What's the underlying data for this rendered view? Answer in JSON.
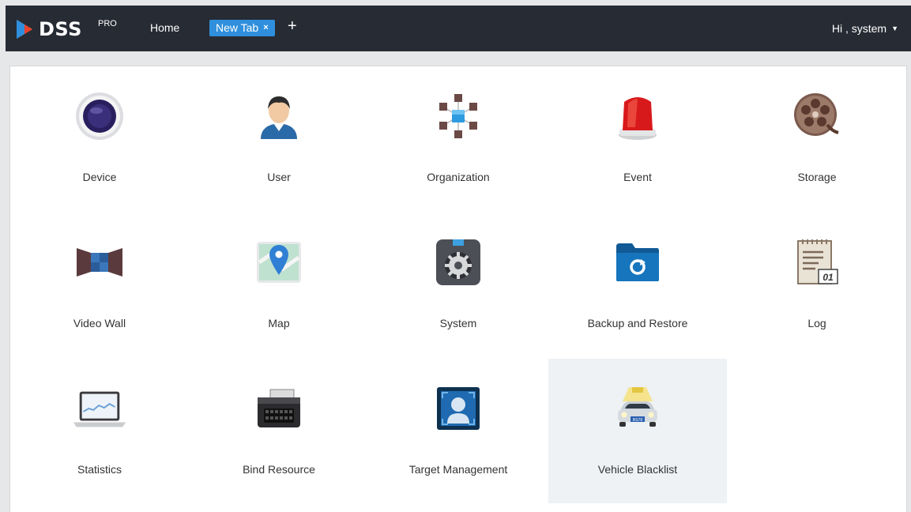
{
  "header": {
    "logo_text": "DSS",
    "logo_sup": "PRO",
    "home_label": "Home",
    "active_tab": "New Tab",
    "tab_close": "×",
    "add_tab": "+",
    "user_greeting": "Hi , system",
    "user_caret": "▼"
  },
  "tiles": [
    {
      "label": "Device",
      "icon": "camera-icon"
    },
    {
      "label": "User",
      "icon": "user-icon"
    },
    {
      "label": "Organization",
      "icon": "organization-icon"
    },
    {
      "label": "Event",
      "icon": "alarm-light-icon"
    },
    {
      "label": "Storage",
      "icon": "film-reel-icon"
    },
    {
      "label": "Video Wall",
      "icon": "video-wall-icon"
    },
    {
      "label": "Map",
      "icon": "map-pin-icon"
    },
    {
      "label": "System",
      "icon": "gear-icon"
    },
    {
      "label": "Backup and Restore",
      "icon": "folder-restore-icon"
    },
    {
      "label": "Log",
      "icon": "log-document-icon"
    },
    {
      "label": "Statistics",
      "icon": "laptop-chart-icon"
    },
    {
      "label": "Bind Resource",
      "icon": "nvr-device-icon"
    },
    {
      "label": "Target Management",
      "icon": "face-frame-icon"
    },
    {
      "label": "Vehicle Blacklist",
      "icon": "vehicle-icon"
    }
  ],
  "license_plate": "BS78",
  "log_date": "01",
  "colors": {
    "topbar": "#272b34",
    "tab": "#2f8fdc",
    "hover_tile": "#eef2f5"
  }
}
